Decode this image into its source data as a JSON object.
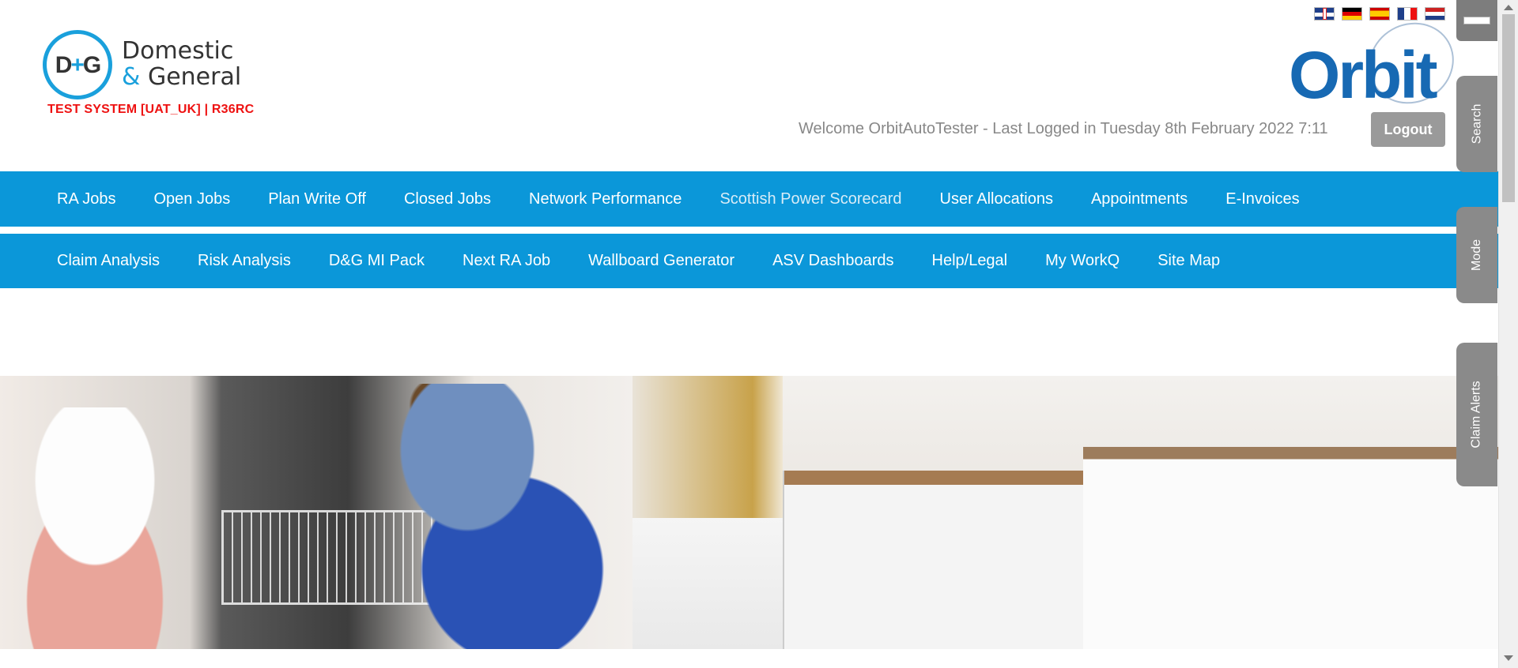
{
  "header": {
    "logo_line1": "Domestic",
    "logo_amp": "&",
    "logo_line2": " General",
    "logo_mark_left": "D",
    "logo_mark_plus": "+",
    "logo_mark_right": "G",
    "test_banner": "TEST SYSTEM [UAT_UK] | R36RC",
    "product_name": "Orbit",
    "welcome_text": "Welcome OrbitAutoTester - Last Logged in Tuesday 8th February 2022 7:11",
    "logout_label": "Logout"
  },
  "languages": [
    "English",
    "German",
    "Spanish",
    "French",
    "Dutch"
  ],
  "nav_primary": [
    "RA Jobs",
    "Open Jobs",
    "Plan Write Off",
    "Closed Jobs",
    "Network Performance",
    "Scottish Power Scorecard",
    "User Allocations",
    "Appointments",
    "E-Invoices"
  ],
  "nav_secondary": [
    "Claim Analysis",
    "Risk Analysis",
    "D&G MI Pack",
    "Next RA Job",
    "Wallboard Generator",
    "ASV Dashboards",
    "Help/Legal",
    "My WorkQ",
    "Site Map"
  ],
  "side_tabs": {
    "search": "Search",
    "mode": "Mode",
    "claim_alerts": "Claim Alerts"
  },
  "colors": {
    "nav_blue": "#0b97d9",
    "brand_blue": "#1769b3",
    "test_red": "#ee1111",
    "tab_grey": "#8a8a8a"
  }
}
